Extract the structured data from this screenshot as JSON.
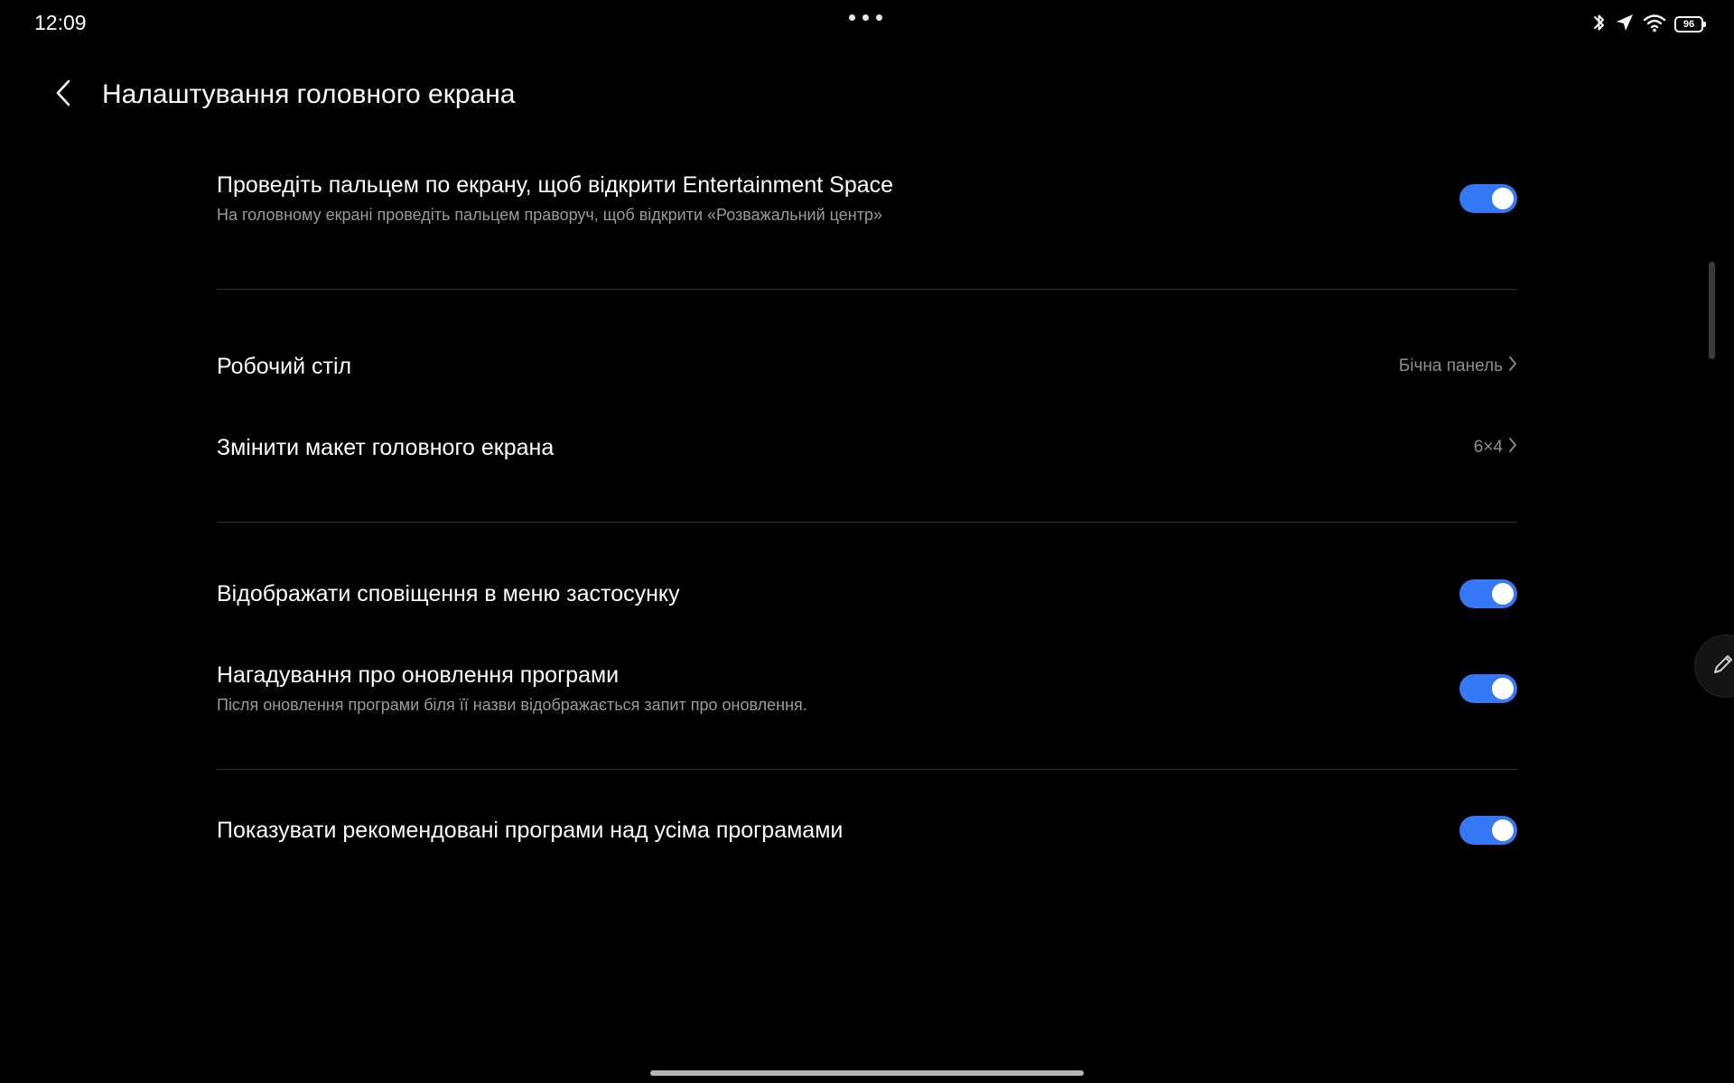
{
  "status_bar": {
    "time": "12:09",
    "battery": "96",
    "icons": [
      "bluetooth-icon",
      "location-arrow-icon",
      "wifi-icon",
      "battery-icon"
    ]
  },
  "header": {
    "title": "Налаштування головного екрана",
    "back_icon": "chevron-left-icon"
  },
  "settings": {
    "entertainment_swipe": {
      "title": "Проведіть пальцем по екрану, щоб відкрити Entertainment Space",
      "subtitle": "На головному екрані проведіть пальцем праворуч, щоб відкрити «Розважальний центр»",
      "enabled": true
    },
    "desktop": {
      "title": "Робочий стіл",
      "value": "Бічна панель"
    },
    "layout": {
      "title": "Змінити макет головного екрана",
      "value": "6×4"
    },
    "app_menu_notifications": {
      "title": "Відображати сповіщення в меню застосунку",
      "enabled": true
    },
    "update_reminder": {
      "title": "Нагадування про оновлення програми",
      "subtitle": "Після оновлення програми біля її назви відображається запит про оновлення.",
      "enabled": true
    },
    "recommended_apps": {
      "title": "Показувати рекомендовані програми над усіма програмами",
      "enabled": true
    }
  },
  "colors": {
    "background": "#000000",
    "toggle_on": "#3478f6",
    "secondary_text": "#9a9a9a"
  }
}
